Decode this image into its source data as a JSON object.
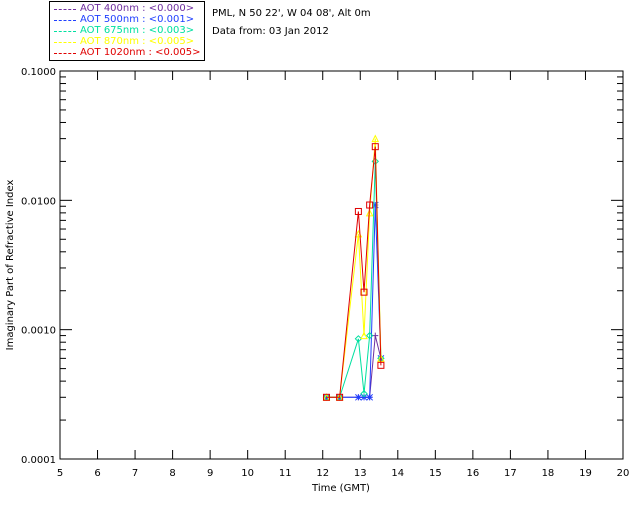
{
  "header": {
    "site": "PML, N 50 22', W 04 08', Alt 0m",
    "date": "Data from: 03 Jan 2012"
  },
  "legend": [
    {
      "label": "AOT  400nm : <0.000>",
      "color": "#6f2f9f"
    },
    {
      "label": "AOT  500nm : <0.001>",
      "color": "#1f3fff"
    },
    {
      "label": "AOT  675nm : <0.003>",
      "color": "#00e0a0"
    },
    {
      "label": "AOT  870nm : <0.005>",
      "color": "#ffff00"
    },
    {
      "label": "AOT 1020nm : <0.005>",
      "color": "#e00000"
    }
  ],
  "chart_data": {
    "type": "line",
    "title": "",
    "xlabel": "Time (GMT)",
    "ylabel": "Imaginary Part of Refractive Index",
    "xlim": [
      5,
      20
    ],
    "ylim": [
      0.0001,
      0.1
    ],
    "yscale": "log",
    "xticks": [
      "5",
      "6",
      "7",
      "8",
      "9",
      "10",
      "11",
      "12",
      "13",
      "14",
      "15",
      "16",
      "17",
      "18",
      "19",
      "20"
    ],
    "yticks": [
      "0.0001",
      "0.0010",
      "0.0100",
      "0.1000"
    ],
    "series": [
      {
        "name": "AOT  400nm : <0.000>",
        "color": "#6f2f9f",
        "marker": "plus",
        "x": [
          12.1,
          12.45,
          12.95,
          13.1,
          13.25,
          13.4,
          13.55
        ],
        "y": [
          0.0003,
          0.0003,
          0.0003,
          0.0003,
          0.0003,
          0.0009,
          0.0006
        ]
      },
      {
        "name": "AOT  500nm : <0.001>",
        "color": "#1f3fff",
        "marker": "asterisk",
        "x": [
          12.1,
          12.45,
          12.95,
          13.1,
          13.25,
          13.4,
          13.55
        ],
        "y": [
          0.0003,
          0.0003,
          0.0003,
          0.0003,
          0.0003,
          0.0092,
          0.0006
        ]
      },
      {
        "name": "AOT  675nm : <0.003>",
        "color": "#00e0a0",
        "marker": "diamond",
        "x": [
          12.1,
          12.45,
          12.95,
          13.1,
          13.25,
          13.4,
          13.55
        ],
        "y": [
          0.0003,
          0.0003,
          0.00085,
          0.00032,
          0.0009,
          0.02,
          0.0006
        ]
      },
      {
        "name": "AOT  870nm : <0.005>",
        "color": "#ffff00",
        "marker": "triangle",
        "x": [
          12.1,
          12.45,
          12.95,
          13.1,
          13.25,
          13.4,
          13.55
        ],
        "y": [
          0.0003,
          0.0003,
          0.0055,
          0.0009,
          0.008,
          0.03,
          0.0006
        ]
      },
      {
        "name": "AOT 1020nm : <0.005>",
        "color": "#e00000",
        "marker": "square",
        "x": [
          12.1,
          12.45,
          12.95,
          13.1,
          13.25,
          13.4,
          13.55
        ],
        "y": [
          0.0003,
          0.0003,
          0.0082,
          0.00195,
          0.0092,
          0.026,
          0.00053
        ]
      }
    ]
  }
}
